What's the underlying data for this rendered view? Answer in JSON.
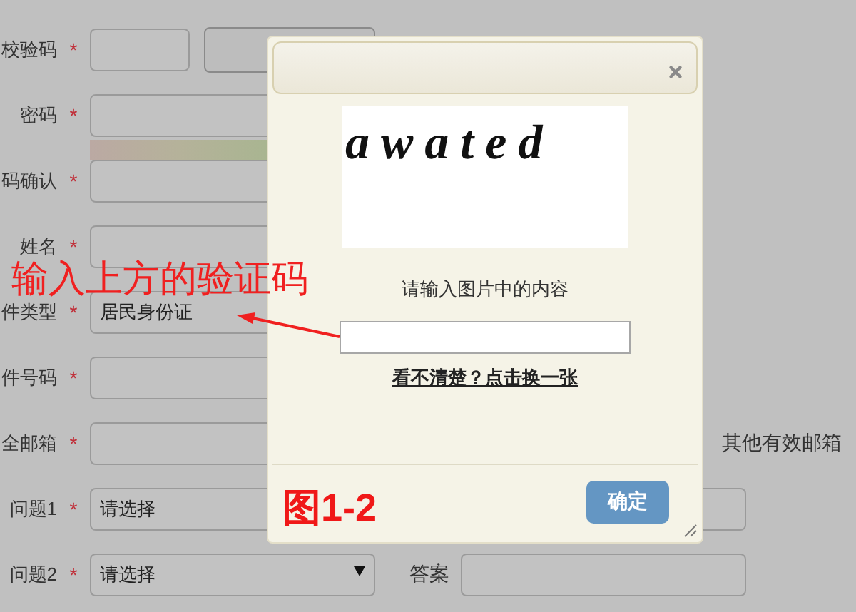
{
  "form": {
    "rows": [
      {
        "kind": "code",
        "label": "校验码",
        "required": "*"
      },
      {
        "kind": "password",
        "label": "密码",
        "required": "*"
      },
      {
        "kind": "text",
        "label": "码确认",
        "required": "*"
      },
      {
        "kind": "text",
        "label": "姓名",
        "required": "*"
      },
      {
        "kind": "text",
        "label": "件类型",
        "required": "*",
        "value": "居民身份证"
      },
      {
        "kind": "text",
        "label": "件号码",
        "required": "*"
      },
      {
        "kind": "text",
        "label": "全邮箱",
        "required": "*",
        "hint": "其他有效邮箱"
      },
      {
        "kind": "select",
        "label": "问题1",
        "required": "*",
        "value": "请选择",
        "answer": {}
      },
      {
        "kind": "select",
        "label": "问题2",
        "required": "*",
        "value": "请选择",
        "caret": true,
        "answer": {
          "label": "答案"
        }
      }
    ]
  },
  "dialog": {
    "captcha": "awated",
    "prompt": "请输入图片中的内容",
    "link": "看不清楚？点击换一张",
    "button": "确定"
  },
  "annotations": [
    {
      "kind": "callout",
      "text": "输入上方的验证码"
    },
    {
      "kind": "figure_label",
      "text": "图1-2"
    }
  ]
}
